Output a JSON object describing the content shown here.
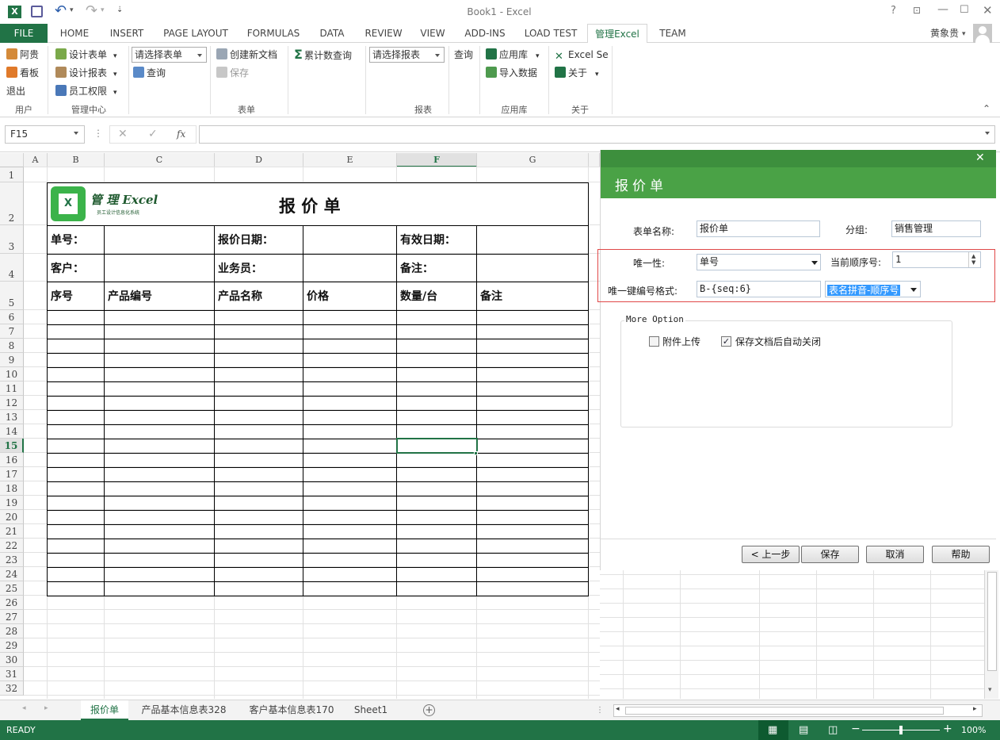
{
  "title": "Book1 - Excel",
  "user": "黄象贵",
  "tabs": [
    "FILE",
    "HOME",
    "INSERT",
    "PAGE LAYOUT",
    "FORMULAS",
    "DATA",
    "REVIEW",
    "VIEW",
    "ADD-INS",
    "LOAD TEST",
    "管理Excel",
    "TEAM"
  ],
  "ribbon": {
    "user_group": {
      "items": [
        "阿贵",
        "看板",
        "退出"
      ],
      "label": "用户"
    },
    "admin_group": {
      "items": [
        "设计表单",
        "设计报表",
        "员工权限"
      ],
      "label": "管理中心"
    },
    "form_group": {
      "select": "请选择表单",
      "query": "查询",
      "create": "创建新文档",
      "save": "保存",
      "label": "表单"
    },
    "report_group": {
      "cumulative": "累计数查询",
      "select": "请选择报表",
      "query": "查询",
      "label": "报表"
    },
    "app_group": {
      "library": "应用库",
      "import": "导入数据",
      "label": "应用库"
    },
    "about_group": {
      "excel": "Excel Se",
      "about": "关于",
      "label": "关于"
    }
  },
  "formula_bar": {
    "name_box": "F15",
    "fx": "fx",
    "value": ""
  },
  "columns": [
    "A",
    "B",
    "C",
    "D",
    "E",
    "F",
    "G"
  ],
  "rows": [
    "1",
    "2",
    "3",
    "4",
    "5",
    "6",
    "7",
    "8",
    "9",
    "10",
    "11",
    "12",
    "13",
    "14",
    "15",
    "16",
    "17",
    "18",
    "19",
    "20",
    "21",
    "22",
    "23",
    "24",
    "25",
    "26",
    "27",
    "28",
    "29",
    "30",
    "31",
    "32"
  ],
  "sheet": {
    "logo_text": "管 理 Excel",
    "logo_sub": "员工设计信息化系统",
    "title": "报 价 单",
    "row3": [
      "单号：",
      "报价日期：",
      "有效日期："
    ],
    "row4": [
      "客户：",
      "业务员：",
      "备注："
    ],
    "headers": [
      "序号",
      "产品编号",
      "产品名称",
      "价格",
      "数量/台",
      "备注"
    ]
  },
  "panel": {
    "header": "报价单",
    "form_name_label": "表单名称:",
    "form_name": "报价单",
    "group_label": "分组:",
    "group": "销售管理",
    "unique_label": "唯一性:",
    "unique": "单号",
    "seq_label": "当前顺序号:",
    "seq": "1",
    "format_label": "唯一键编号格式:",
    "format": "B-{seq:6}",
    "format_select": "表名拼音-顺序号",
    "more_option": "More Option",
    "attach": "附件上传",
    "attach_checked": false,
    "autoclose": "保存文档后自动关闭",
    "autoclose_checked": true,
    "buttons": [
      "< 上一步",
      "保存",
      "取消",
      "帮助"
    ]
  },
  "sheet_tabs": [
    "报价单",
    "产品基本信息表328",
    "客户基本信息表170",
    "Sheet1"
  ],
  "status": {
    "ready": "READY",
    "zoom": "100%"
  },
  "colors": {
    "excel_green": "#217346",
    "panel_header": "#4aa246",
    "highlight": "#e04848"
  }
}
